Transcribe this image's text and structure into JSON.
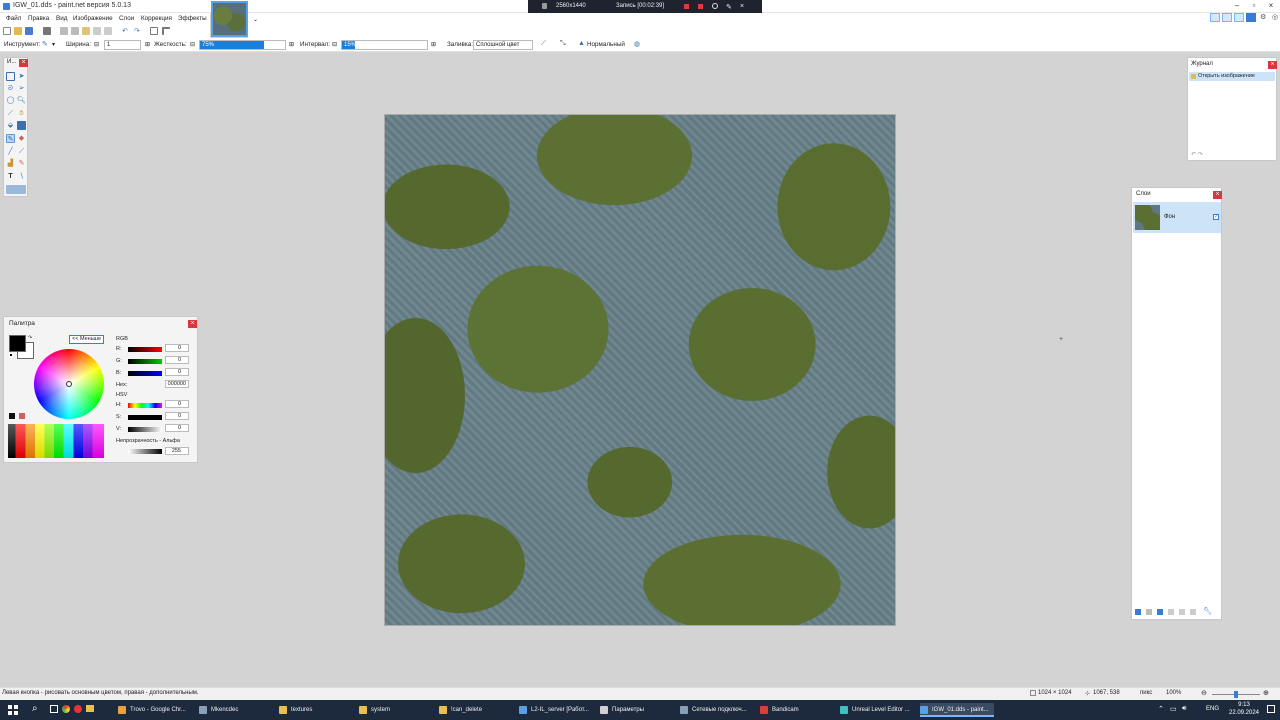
{
  "window": {
    "title": "IGW_01.dds - paint.net версия 5.0.13"
  },
  "recording": {
    "resolution": "2560x1440",
    "status": "Запись [00:02:39]"
  },
  "menu": {
    "items": [
      "Файл",
      "Правка",
      "Вид",
      "Изображение",
      "Слои",
      "Коррекция",
      "Эффекты"
    ]
  },
  "options_bar": {
    "tool_label": "Инструмент:",
    "width_label": "Ширина:",
    "width_value": "1",
    "hardness_label": "Жесткость:",
    "hardness_value": "75%",
    "hardness_fraction": 0.75,
    "interval_label": "Интервал:",
    "interval_value": "15%",
    "interval_fraction": 0.15,
    "fill_label": "Заливка:",
    "fill_value": "Сплошной цвет",
    "blend_value": "Нормальный"
  },
  "tools_panel": {
    "title": "И..."
  },
  "palette": {
    "title": "Палитра",
    "less_button": "<< Меньше",
    "rgb_label": "RGB",
    "r_label": "R:",
    "r_value": "0",
    "g_label": "G:",
    "g_value": "0",
    "b_label": "B:",
    "b_value": "0",
    "hex_label": "Hex:",
    "hex_value": "000000",
    "hsv_label": "HSV",
    "h_label": "H:",
    "h_value": "0",
    "s_label": "S:",
    "s_value": "0",
    "v_label": "V:",
    "v_value": "0",
    "opacity_label": "Непрозрачность - Альфа",
    "opacity_value": "255",
    "primary_color": "#000000",
    "secondary_color": "#ffffff"
  },
  "journal": {
    "title": "Журнал",
    "items": [
      "Открыть изображение"
    ]
  },
  "layers": {
    "title": "Слои",
    "items": [
      {
        "name": "Фон",
        "visible": true
      }
    ]
  },
  "status": {
    "hint": "Левая кнопка - рисовать основным цветом, правая - дополнительным.",
    "image_size": "1024 × 1024",
    "cursor_pos": "1067, 538",
    "units": "пикс",
    "zoom": "100%"
  },
  "taskbar": {
    "items": [
      {
        "label": "Trovo - Google Chr...",
        "color": "#e9a23b"
      },
      {
        "label": "Mkencdec",
        "color": "#8aa0b8"
      },
      {
        "label": "textures",
        "color": "#e8c34a"
      },
      {
        "label": "system",
        "color": "#e8c34a"
      },
      {
        "label": "!can_delete",
        "color": "#e8c34a"
      },
      {
        "label": "L2-IL_server [Работ...",
        "color": "#5aa0e6"
      },
      {
        "label": "Параметры",
        "color": "#d0d0d0"
      },
      {
        "label": "Сетевые подключ...",
        "color": "#8aa0b8"
      },
      {
        "label": "Bandicam",
        "color": "#e03a3a"
      },
      {
        "label": "Unreal Level Editor ...",
        "color": "#40c0c0"
      },
      {
        "label": "IGW_01.dds - paint...",
        "color": "#5aa0e6",
        "active": true
      }
    ],
    "lang": "ENG",
    "time": "9:13",
    "date": "22.09.2024"
  }
}
